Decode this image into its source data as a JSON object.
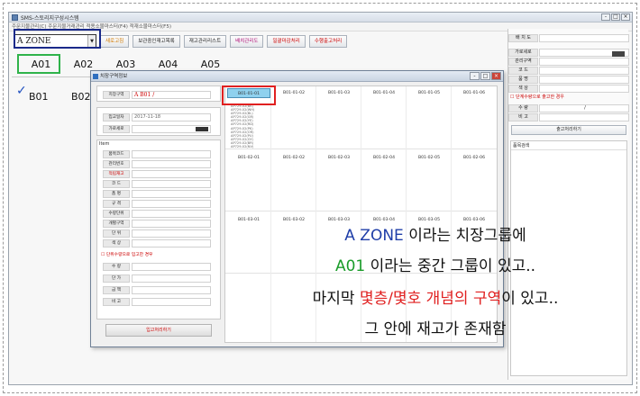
{
  "window": {
    "title": "SMS-스토리지구성시스템",
    "menu": "주문지물관리(C)  주문지물거래관리  적용소물마스터(F4)  적재소물마스터(F5)"
  },
  "toolbar": {
    "zone_value": "A ZONE",
    "buttons": [
      "새로고침",
      "보관중인재고목록",
      "재고관리리스트",
      "배치관리도",
      "일괄마감처리",
      "수행출고처리"
    ]
  },
  "main": {
    "row_a": [
      "A01",
      "A02",
      "A03",
      "A04",
      "A05"
    ],
    "row_b": [
      "B01",
      "B02"
    ]
  },
  "right_panel": {
    "rows": [
      {
        "label": "배 치 도",
        "value": ""
      },
      {
        "label": "가로세로",
        "value": ""
      },
      {
        "label": "관리구역",
        "value": ""
      },
      {
        "label": "코   드",
        "value": ""
      },
      {
        "label": "품   명",
        "value": ""
      },
      {
        "label": "색   상",
        "value": ""
      }
    ],
    "checkbox": "단계수량으로 출고한 경우",
    "qty_rows": [
      {
        "label": "수   량",
        "value": "/"
      },
      {
        "label": "비   고",
        "value": ""
      }
    ],
    "button": "출고처리하기",
    "list_header": "품목검색"
  },
  "dialog": {
    "title": "치장구역정보",
    "zone_label": "치장구역",
    "zone_value": "A  B01 /",
    "date_label": "입고일자",
    "date_value": "2017-11-18",
    "size_label": "가로세로",
    "section": "Item",
    "item_rows": [
      "품목코드",
      "관리번호",
      "적립재고",
      "코   드",
      "품   명",
      "규   격",
      "수량단위",
      "개별구역",
      "단   위",
      "색   상"
    ],
    "checkbox": "단위수량으로 입고한 경우",
    "qty_rows": [
      "수   량",
      "단   가",
      "금   액",
      "비   고"
    ],
    "submit": "입고처리하기",
    "grid_rows": [
      [
        "B01-01-01",
        "B01-01-02",
        "B01-01-03",
        "B01-01-04",
        "B01-01-05",
        "B01-01-06"
      ],
      [
        "B01-02-01",
        "B01-02-02",
        "B01-02-03",
        "B01-02-04",
        "B01-02-05",
        "B01-02-06"
      ],
      [
        "B01-03-01",
        "B01-03-02",
        "B01-03-03",
        "B01-03-04",
        "B01-03-05",
        "B01-03-06"
      ]
    ],
    "selected_cell_list": [
      "AP729-02(BK)",
      "AP729-02(WH)",
      "AP729-02(BL)",
      "AP729-02(GR)",
      "AP729-02(YE)",
      "AP729-02(RD)",
      "AP729-02(PK)",
      "AP729-02(OR)",
      "AP729-02(PU)",
      "AP729-02(GY)",
      "AP729-02(BR)",
      "AP729-02(NV)"
    ]
  },
  "annotation": {
    "line1_a": "A ZONE",
    "line1_b": " 이라는 치장그룹에",
    "line2_a": "A01",
    "line2_b": " 이라는 중간 그룹이 있고..",
    "line3_a": "마지막 ",
    "line3_b": "몇층/몇호 개념의",
    "line3_c": " 구역",
    "line3_d": "이 있고..",
    "line4": "그 안에 재고가 존재함"
  },
  "colors": {
    "zone_box": "#1a2a8a",
    "a01_box": "#2fb34a",
    "cell_box": "#e02020",
    "selected_cell": "#8fd1ee"
  }
}
